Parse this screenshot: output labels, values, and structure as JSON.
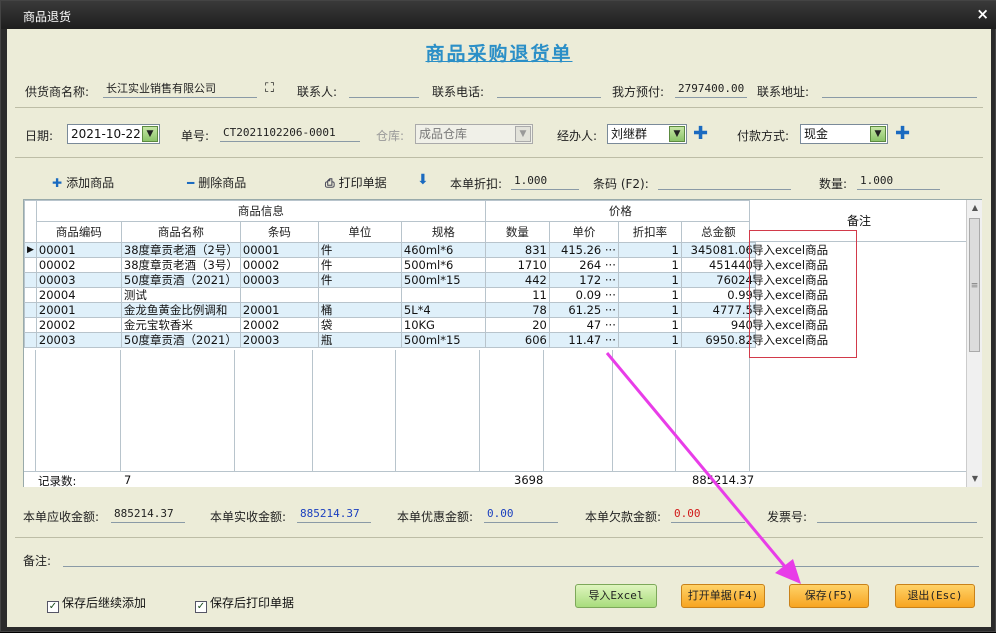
{
  "window": {
    "title": "商品退货",
    "close": "×"
  },
  "heading": "商品采购退货单",
  "supplier": {
    "name_label": "供货商名称:",
    "name": "长江实业销售有限公司",
    "contact_label": "联系人:",
    "contact": "",
    "phone_label": "联系电话:",
    "phone": "",
    "prepay_label": "我方预付:",
    "prepay": "2797400.00",
    "address_label": "联系地址:",
    "address": ""
  },
  "meta": {
    "date_label": "日期:",
    "date": "2021-10-22",
    "no_label": "单号:",
    "no": "CT2021102206-0001",
    "warehouse_label": "仓库:",
    "warehouse": "成品仓库",
    "handler_label": "经办人:",
    "handler": "刘继群",
    "pay_label": "付款方式:",
    "pay": "现金"
  },
  "toolbar": {
    "add": "添加商品",
    "delete": "删除商品",
    "print": "打印单据",
    "discount_label": "本单折扣:",
    "discount": "1.000",
    "barcode_label": "条码 (F2):",
    "barcode": "",
    "qty_label": "数量:",
    "qty": "1.000"
  },
  "grid": {
    "group_headers": [
      "商品信息",
      "价格"
    ],
    "columns": [
      "商品编码",
      "商品名称",
      "条码",
      "单位",
      "规格",
      "数量",
      "单价",
      "折扣率",
      "总金额"
    ],
    "remark_header": "备注",
    "rows": [
      {
        "code": "00001",
        "name": "38度章贡老酒（2号）",
        "barcode": "00001",
        "unit": "件",
        "spec": "460ml*6",
        "qty": "831",
        "price": "415.26 ···",
        "rate": "1",
        "total": "345081.06",
        "remark": "导入excel商品"
      },
      {
        "code": "00002",
        "name": "38度章贡老酒（3号）",
        "barcode": "00002",
        "unit": "件",
        "spec": "500ml*6",
        "qty": "1710",
        "price": "264 ···",
        "rate": "1",
        "total": "451440",
        "remark": "导入excel商品"
      },
      {
        "code": "00003",
        "name": "50度章贡酒（2021）",
        "barcode": "00003",
        "unit": "件",
        "spec": "500ml*15",
        "qty": "442",
        "price": "172 ···",
        "rate": "1",
        "total": "76024",
        "remark": "导入excel商品"
      },
      {
        "code": "20004",
        "name": "测试",
        "barcode": "",
        "unit": "",
        "spec": "",
        "qty": "11",
        "price": "0.09 ···",
        "rate": "1",
        "total": "0.99",
        "remark": "导入excel商品"
      },
      {
        "code": "20001",
        "name": "金龙鱼黄金比例调和",
        "barcode": "20001",
        "unit": "桶",
        "spec": "5L*4",
        "qty": "78",
        "price": "61.25 ···",
        "rate": "1",
        "total": "4777.5",
        "remark": "导入excel商品"
      },
      {
        "code": "20002",
        "name": "金元宝软香米",
        "barcode": "20002",
        "unit": "袋",
        "spec": "10KG",
        "qty": "20",
        "price": "47 ···",
        "rate": "1",
        "total": "940",
        "remark": "导入excel商品"
      },
      {
        "code": "20003",
        "name": "50度章贡酒（2021）",
        "barcode": "20003",
        "unit": "瓶",
        "spec": "500ml*15",
        "qty": "606",
        "price": "11.47 ···",
        "rate": "1",
        "total": "6950.82",
        "remark": "导入excel商品"
      }
    ],
    "footer": {
      "label": "记录数:",
      "count": "7",
      "qty_total": "3698",
      "amount_total": "885214.37"
    }
  },
  "totals": {
    "receivable_label": "本单应收金额:",
    "receivable": "885214.37",
    "received_label": "本单实收金额:",
    "received": "885214.37",
    "discount_label": "本单优惠金额:",
    "discount": "0.00",
    "owed_label": "本单欠款金额:",
    "owed": "0.00",
    "invoice_label": "发票号:",
    "invoice": ""
  },
  "remark": {
    "label": "备注:",
    "value": ""
  },
  "options": {
    "continue_add": "保存后继续添加",
    "print_after": "保存后打印单据"
  },
  "buttons": {
    "import": "导入Excel",
    "open": "打开单据(F4)",
    "save": "保存(F5)",
    "exit": "退出(Esc)"
  },
  "colors": {
    "heading": "#2b8fc7",
    "received": "#1a3fbf",
    "discount": "#1a3fbf",
    "owed": "#d11a1a",
    "arrow": "#e83de8",
    "row_alt": "#dff0fa"
  }
}
